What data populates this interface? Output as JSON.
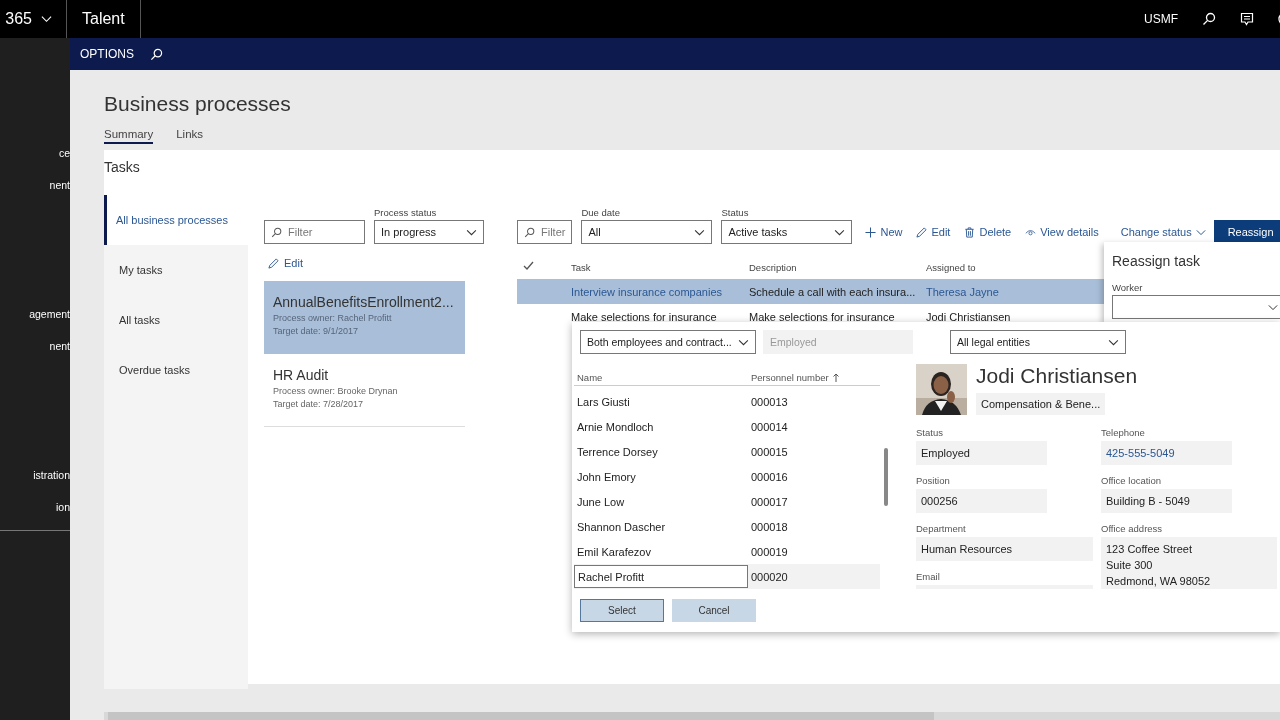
{
  "top_bar": {
    "app_name": "365",
    "module": "Talent",
    "company": "USMF"
  },
  "nav_pane": {
    "items": [
      "ce",
      "nent",
      "agement",
      "nent",
      "istration",
      "ion"
    ]
  },
  "options_bar": {
    "label": "OPTIONS"
  },
  "page": {
    "title": "Business processes",
    "tabs": [
      {
        "label": "Summary",
        "selected": true
      },
      {
        "label": "Links",
        "selected": false
      }
    ]
  },
  "tasks": {
    "heading": "Tasks",
    "views": [
      {
        "label": "All business processes",
        "selected": true
      },
      {
        "label": "My tasks",
        "selected": false
      },
      {
        "label": "All tasks",
        "selected": false
      },
      {
        "label": "Overdue tasks",
        "selected": false
      }
    ],
    "process_filter": {
      "placeholder": "Filter"
    },
    "process_status": {
      "label": "Process status",
      "value": "In progress"
    },
    "edit": "Edit",
    "processes": [
      {
        "name": "AnnualBenefitsEnrollment2...",
        "owner": "Process owner: Rachel Profitt",
        "target": "Target date: 9/1/2017",
        "selected": true
      },
      {
        "name": "HR Audit",
        "owner": "Process owner: Brooke Drynan",
        "target": "Target date: 7/28/2017",
        "selected": false
      }
    ],
    "task_filter": {
      "placeholder": "Filter"
    },
    "due_date": {
      "label": "Due date",
      "value": "All"
    },
    "status": {
      "label": "Status",
      "value": "Active tasks"
    },
    "actions": [
      {
        "kind": "new",
        "label": "New"
      },
      {
        "kind": "edit",
        "label": "Edit"
      },
      {
        "kind": "delete",
        "label": "Delete"
      },
      {
        "kind": "view",
        "label": "View details"
      },
      {
        "kind": "menu",
        "label": "Change status"
      },
      {
        "kind": "primary",
        "label": "Reassign"
      }
    ],
    "grid": {
      "columns": [
        "Task",
        "Description",
        "Assigned to"
      ],
      "rows": [
        {
          "task": "Interview insurance companies",
          "description": "Schedule a call with each insura...",
          "assigned_to": "Theresa Jayne",
          "selected": true
        },
        {
          "task": "Make selections for insurance",
          "description": "Make selections for insurance",
          "assigned_to": "Jodi Christiansen",
          "selected": false
        }
      ]
    }
  },
  "reassign_panel": {
    "title": "Reassign task",
    "worker_label": "Worker"
  },
  "lookup": {
    "worker_type": "Both employees and contract...",
    "employment": {
      "value": "Employed",
      "disabled": true
    },
    "legal_entity": "All legal entities",
    "columns": [
      {
        "label": "Name",
        "sorted": false
      },
      {
        "label": "Personnel number",
        "sorted": true
      }
    ],
    "rows": [
      {
        "name": "Lars Giusti",
        "number": "000013",
        "selected": false
      },
      {
        "name": "Arnie Mondloch",
        "number": "000014",
        "selected": false
      },
      {
        "name": "Terrence Dorsey",
        "number": "000015",
        "selected": false
      },
      {
        "name": "John Emory",
        "number": "000016",
        "selected": false
      },
      {
        "name": "June Low",
        "number": "000017",
        "selected": false
      },
      {
        "name": "Shannon Dascher",
        "number": "000018",
        "selected": false
      },
      {
        "name": "Emil Karafezov",
        "number": "000019",
        "selected": false
      },
      {
        "name": "Rachel Profitt",
        "number": "000020",
        "selected": true
      }
    ],
    "buttons": [
      {
        "kind": "primary",
        "label": "Select"
      },
      {
        "kind": "secondary",
        "label": "Cancel"
      }
    ],
    "profile": {
      "name": "Jodi Christiansen",
      "department_tag": "Compensation & Bene...",
      "fields": [
        {
          "label": "Status",
          "value": "Employed",
          "kind": "text"
        },
        {
          "label": "Telephone",
          "value": "425-555-5049",
          "kind": "link"
        },
        {
          "label": "Position",
          "value": "000256",
          "kind": "text"
        },
        {
          "label": "Office location",
          "value": "Building B - 5049",
          "kind": "text"
        },
        {
          "label": "Department",
          "value": "Human Resources",
          "kind": "wide"
        },
        {
          "label": "Office address",
          "value": "123 Coffee Street\nSuite 300\nRedmond, WA 98052",
          "kind": "address"
        },
        {
          "label": "Email",
          "kind": "empty"
        }
      ]
    }
  }
}
